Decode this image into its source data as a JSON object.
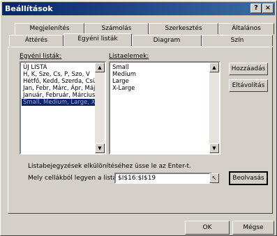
{
  "window": {
    "title": "Beállítások",
    "help_label": "?",
    "close_label": "×"
  },
  "tabs_back": [
    "Megjelenítés",
    "Számolás",
    "Szerkesztés",
    "Általános"
  ],
  "tabs_front": [
    "Áttérés",
    "Egyéni listák",
    "Diagram",
    "Szín"
  ],
  "active_tab": "Egyéni listák",
  "left_list": {
    "label": "Egyéni listák:",
    "items": [
      "ÚJ LISTA",
      "H, K, Sze, Cs, P, Szo, V",
      "Hétfő, Kedd, Szerda, Csüt",
      "Jan, Febr, Márc, Ápr, Máj",
      "Január, Február, Március,",
      "Small, Medium, Large, X"
    ],
    "selected_index": 5
  },
  "right_list": {
    "label": "Listaelemek:",
    "items": [
      "Small",
      "Medium",
      "Large",
      "X-Large"
    ]
  },
  "buttons": {
    "add": "Hozzáadás",
    "delete": "Eltávolítás",
    "import": "Beolvasás",
    "ok": "OK",
    "cancel": "Mégse"
  },
  "hint_text": "Listabejegyzések elkülönítéséhez üsse le az Enter-t.",
  "import_label": "Mely cellákból legyen a lista:",
  "import_value": "$I$16:$I$19",
  "scroll_up_icon": "▲",
  "scroll_down_icon": "▼",
  "ref_icon": "↖"
}
